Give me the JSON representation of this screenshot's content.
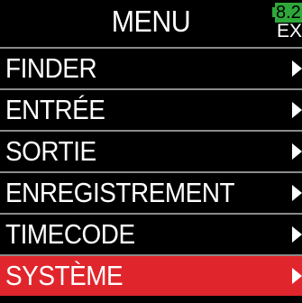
{
  "header": {
    "title": "MENU",
    "battery": {
      "level_text": "8.2",
      "source": "EXT",
      "color": "#2ea83a"
    }
  },
  "menu": {
    "items": [
      {
        "label": "FINDER",
        "selected": false
      },
      {
        "label": "ENTRÉE",
        "selected": false
      },
      {
        "label": "SORTIE",
        "selected": false
      },
      {
        "label": "ENREGISTREMENT",
        "selected": false
      },
      {
        "label": "TIMECODE",
        "selected": false
      },
      {
        "label": "SYSTÈME",
        "selected": true
      }
    ],
    "selected_color": "#e0262c",
    "arrow_icon": "chevron-right-icon"
  }
}
